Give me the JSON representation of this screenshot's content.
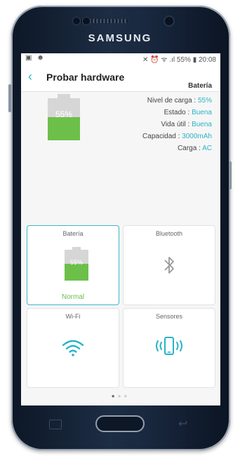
{
  "device": {
    "brand": "SAMSUNG"
  },
  "statusbar": {
    "left_icons": "▣ ☻",
    "right": "✕ ⏰ ᯤ .ıl 55% ▮ 20:08"
  },
  "appbar": {
    "back_glyph": "‹",
    "title": "Probar hardware"
  },
  "battery_summary": {
    "header": "Batería",
    "level_percent": 55,
    "big_percent": "55%",
    "rows": [
      {
        "label": "Nivel de carga : ",
        "value": "55%"
      },
      {
        "label": "Estado : ",
        "value": "Buena"
      },
      {
        "label": "Vida útil : ",
        "value": "Buena"
      },
      {
        "label": "Capacidad : ",
        "value": "3000mAh"
      },
      {
        "label": "Carga : ",
        "value": "AC"
      }
    ]
  },
  "cards": {
    "battery": {
      "title": "Batería",
      "percent": "55%",
      "status": "Normal"
    },
    "bluetooth": {
      "title": "Bluetooth",
      "icon": "bluetooth-icon"
    },
    "wifi": {
      "title": "Wi-Fi",
      "icon": "wifi-icon"
    },
    "sensors": {
      "title": "Sensores",
      "icon": "phone-vibrate-icon"
    }
  },
  "pager": {
    "pages": 3,
    "current": 1
  },
  "colors": {
    "accent": "#2bb3c7",
    "battery_green": "#6cc04a",
    "battery_empty": "#d6d6d6"
  }
}
